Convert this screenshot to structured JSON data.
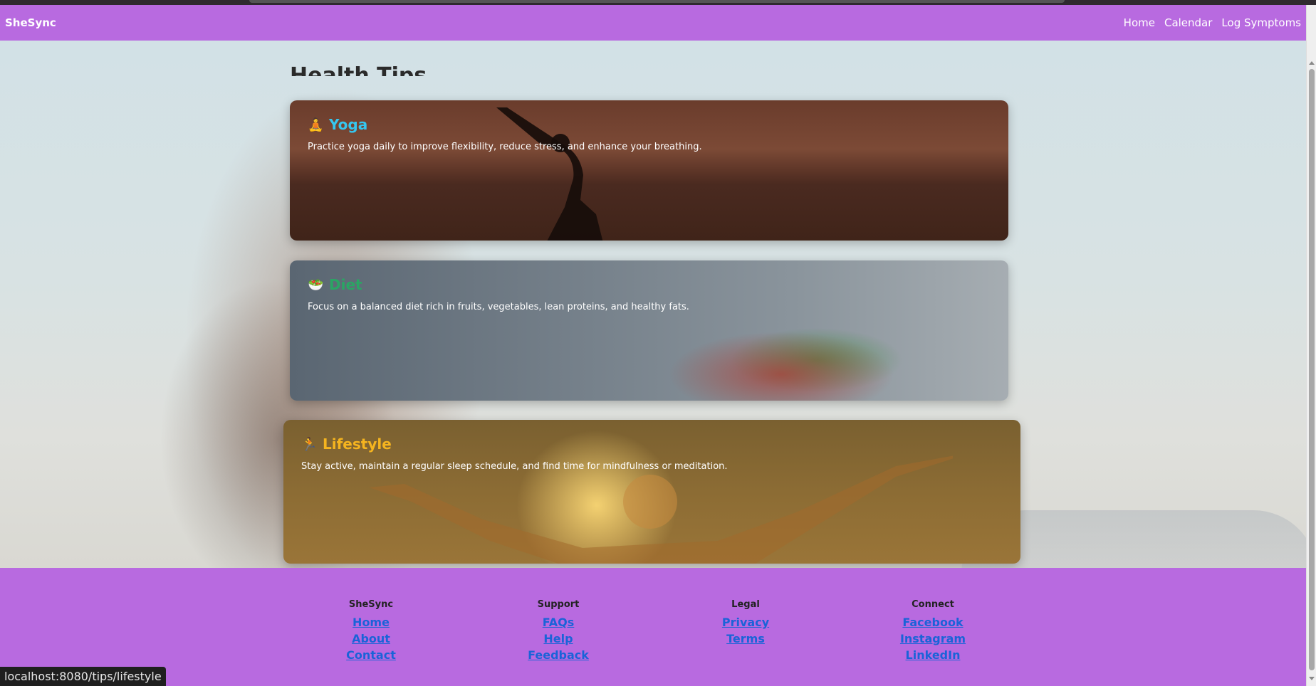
{
  "navbar": {
    "brand": "SheSync",
    "links": [
      "Home",
      "Calendar",
      "Log Symptoms"
    ]
  },
  "page": {
    "heading": "Health Tips"
  },
  "tips": [
    {
      "emoji": "🧘",
      "icon": "yoga-icon",
      "title": "Yoga",
      "color": "#35c6ef",
      "text": "Practice yoga daily to improve flexibility, reduce stress, and enhance your breathing."
    },
    {
      "emoji": "🥗",
      "icon": "salad-icon",
      "title": "Diet",
      "color": "#2aa564",
      "text": "Focus on a balanced diet rich in fruits, vegetables, lean proteins, and healthy fats."
    },
    {
      "emoji": "🏃",
      "icon": "runner-icon",
      "title": "Lifestyle",
      "color": "#f5b41f",
      "text": "Stay active, maintain a regular sleep schedule, and find time for mindfulness or meditation."
    }
  ],
  "footer": {
    "columns": [
      {
        "heading": "SheSync",
        "links": [
          "Home",
          "About",
          "Contact"
        ]
      },
      {
        "heading": "Support",
        "links": [
          "FAQs",
          "Help",
          "Feedback"
        ]
      },
      {
        "heading": "Legal",
        "links": [
          "Privacy",
          "Terms"
        ]
      },
      {
        "heading": "Connect",
        "links": [
          "Facebook",
          "Instagram",
          "LinkedIn"
        ]
      }
    ]
  },
  "status_bar": {
    "url": "localhost:8080/tips/lifestyle"
  },
  "colors": {
    "accent": "#b86ae0",
    "link": "#1a63d8"
  }
}
